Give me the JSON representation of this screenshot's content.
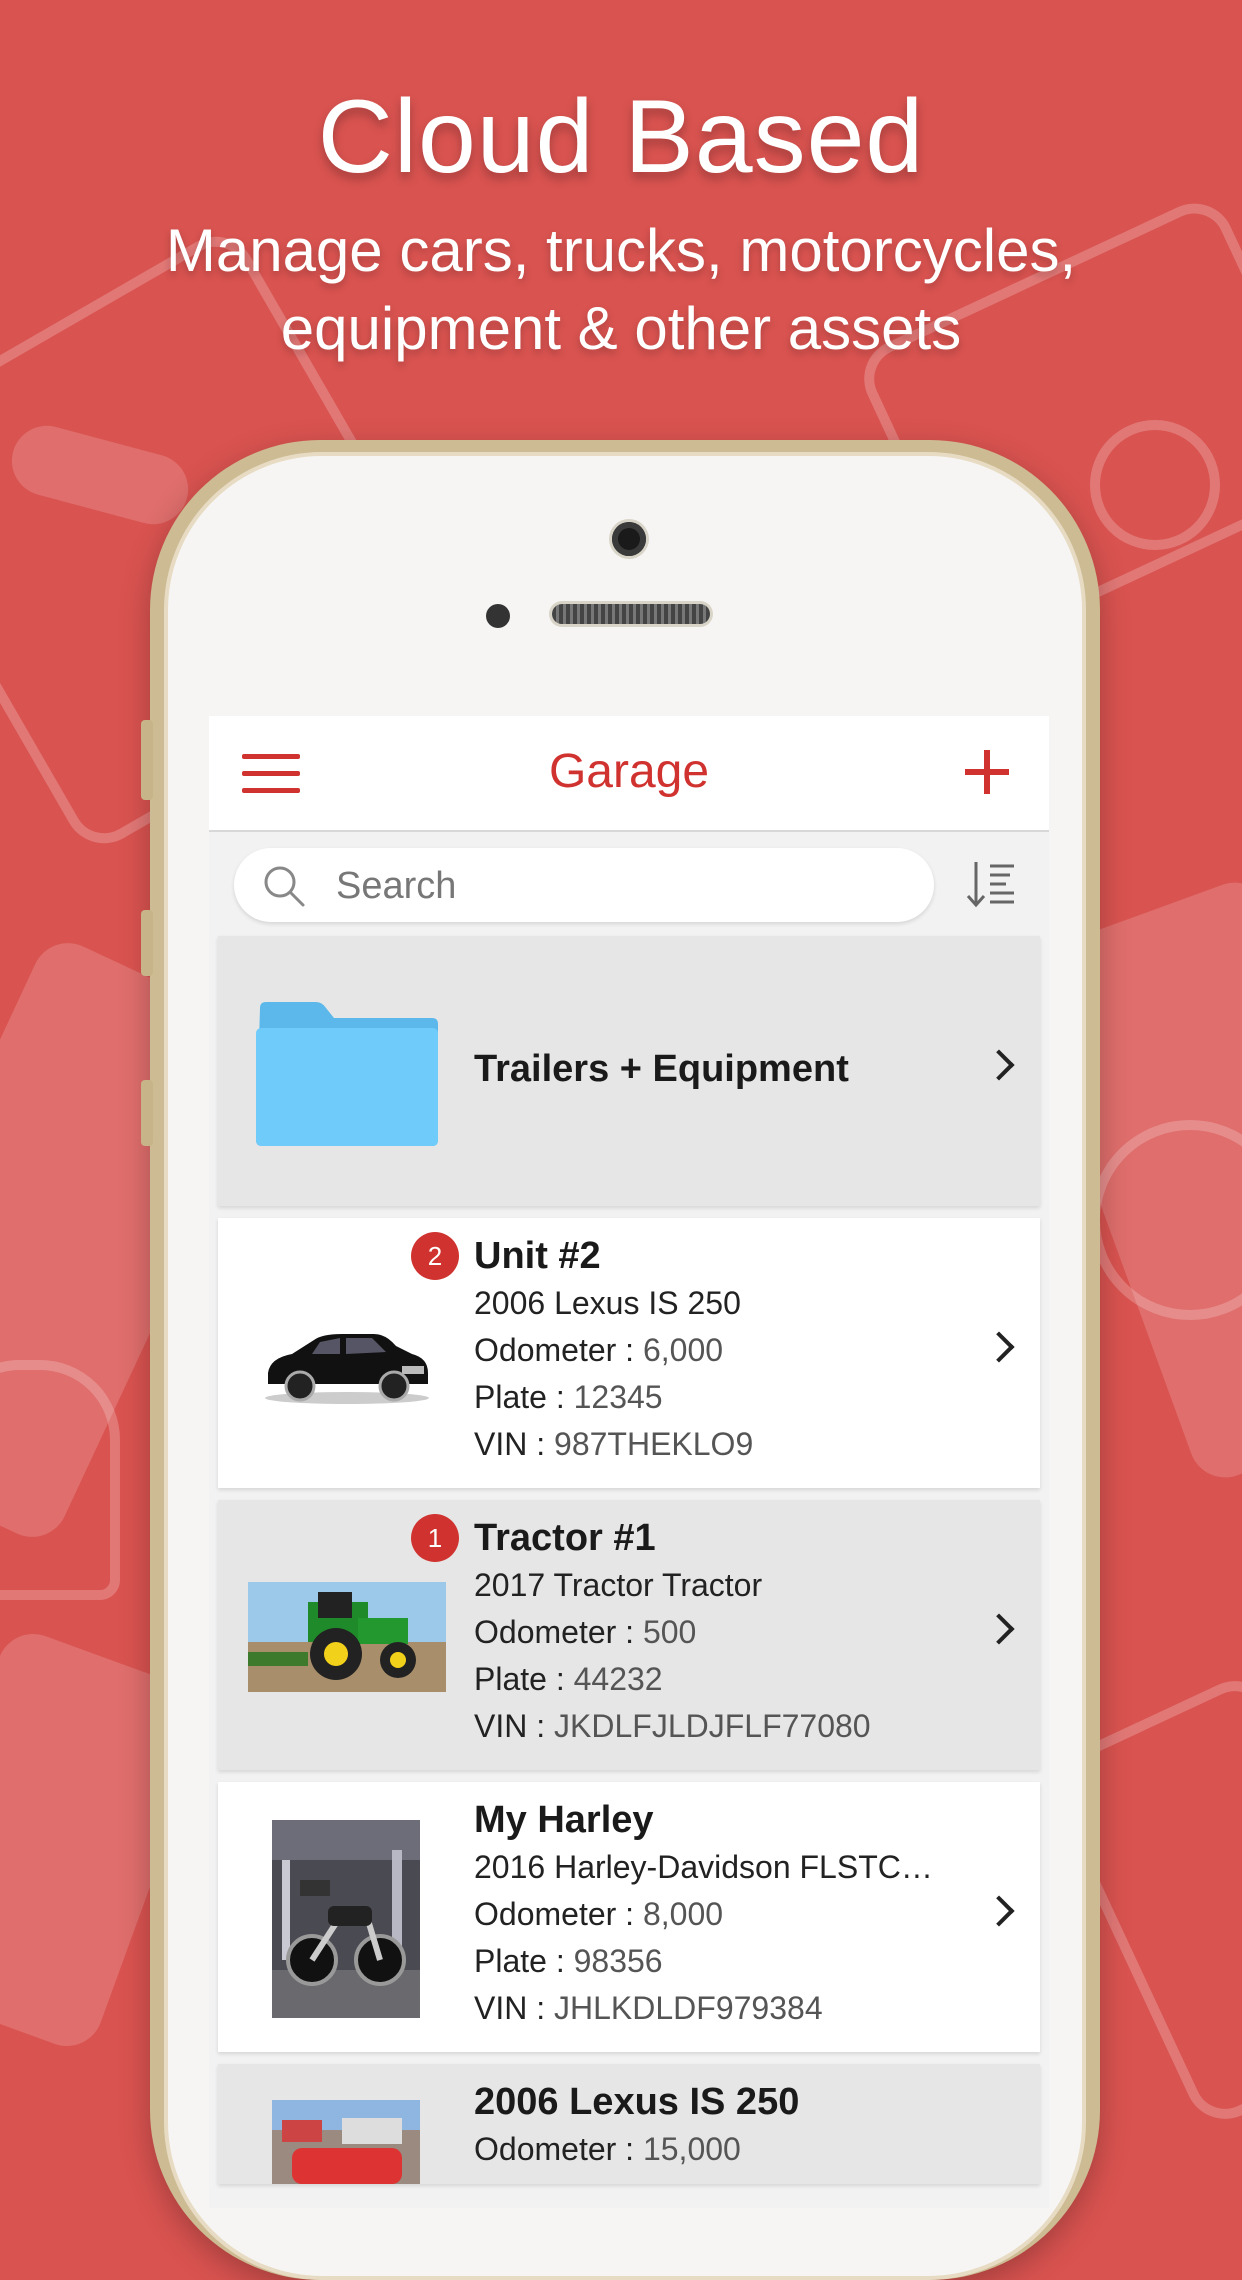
{
  "banner": {
    "headline": "Cloud Based",
    "subline": "Manage cars, trucks, motorcycles, equipment & other assets"
  },
  "app": {
    "title": "Garage",
    "search_placeholder": "Search"
  },
  "folder": {
    "label": "Trailers + Equipment"
  },
  "labels": {
    "odometer": "Odometer : ",
    "plate": "Plate : ",
    "vin": "VIN : "
  },
  "vehicles": [
    {
      "badge": "2",
      "name": "Unit #2",
      "model": "2006 Lexus IS 250",
      "odometer": "6,000",
      "plate": "12345",
      "vin": "987THEKLO9"
    },
    {
      "badge": "1",
      "name": "Tractor #1",
      "model": "2017 Tractor Tractor",
      "odometer": "500",
      "plate": "44232",
      "vin": "JKDLFJLDJFLF77080"
    },
    {
      "name": "My Harley",
      "model": "2016 Harley-Davidson FLSTC…",
      "odometer": "8,000",
      "plate": "98356",
      "vin": "JHLKDLDF979384"
    },
    {
      "name": "2006 Lexus IS 250",
      "odometer": "15,000"
    }
  ],
  "colors": {
    "background": "#d95350",
    "accent": "#d0332f",
    "folder": "#6ecbfa"
  },
  "icons": {
    "menu": "hamburger-menu-icon",
    "add": "plus-icon",
    "search": "search-icon",
    "sort": "sort-icon",
    "folder": "folder-icon",
    "chevron": "chevron-right-icon"
  }
}
